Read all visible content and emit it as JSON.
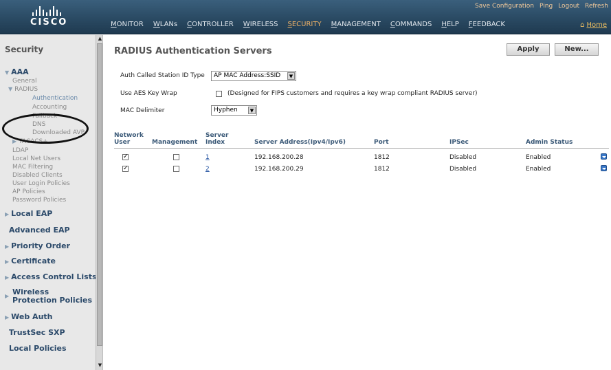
{
  "brand": {
    "name": "cisco"
  },
  "top_links": [
    "Save Configuration",
    "Ping",
    "Logout",
    "Refresh"
  ],
  "nav": [
    "MONITOR",
    "WLANs",
    "CONTROLLER",
    "WIRELESS",
    "SECURITY",
    "MANAGEMENT",
    "COMMANDS",
    "HELP",
    "FEEDBACK"
  ],
  "nav_active": "SECURITY",
  "home_label": "Home",
  "sidebar": {
    "title": "Security",
    "aaa": "AAA",
    "general": "General",
    "radius": "RADIUS",
    "radius_items": [
      "Authentication",
      "Accounting",
      "Fallback",
      "DNS",
      "Downloaded AVP"
    ],
    "tacacs": "TACACS+",
    "aaa_items": [
      "LDAP",
      "Local Net Users",
      "MAC Filtering",
      "Disabled Clients",
      "User Login Policies",
      "AP Policies",
      "Password Policies"
    ],
    "sections": [
      "Local EAP",
      "Advanced EAP",
      "Priority Order",
      "Certificate",
      "Access Control Lists",
      "Wireless Protection Policies",
      "Web Auth",
      "TrustSec SXP",
      "Local Policies"
    ]
  },
  "page": {
    "title": "RADIUS Authentication Servers",
    "apply": "Apply",
    "new": "New...",
    "auth_called_label": "Auth Called Station ID Type",
    "auth_called_value": "AP MAC Address:SSID",
    "aes_label": "Use AES Key Wrap",
    "aes_note": "(Designed for FIPS customers and requires a key wrap compliant RADIUS server)",
    "mac_label": "MAC Delimiter",
    "mac_value": "Hyphen"
  },
  "table": {
    "headers": {
      "network_user_1": "Network",
      "network_user_2": "User",
      "management": "Management",
      "server_index_1": "Server",
      "server_index_2": "Index",
      "address": "Server Address(Ipv4/Ipv6)",
      "port": "Port",
      "ipsec": "IPSec",
      "admin_status": "Admin Status"
    },
    "rows": [
      {
        "network_user": true,
        "management": false,
        "index": "1",
        "address": "192.168.200.28",
        "port": "1812",
        "ipsec": "Disabled",
        "admin_status": "Enabled"
      },
      {
        "network_user": true,
        "management": false,
        "index": "2",
        "address": "192.168.200.29",
        "port": "1812",
        "ipsec": "Disabled",
        "admin_status": "Enabled"
      }
    ]
  }
}
